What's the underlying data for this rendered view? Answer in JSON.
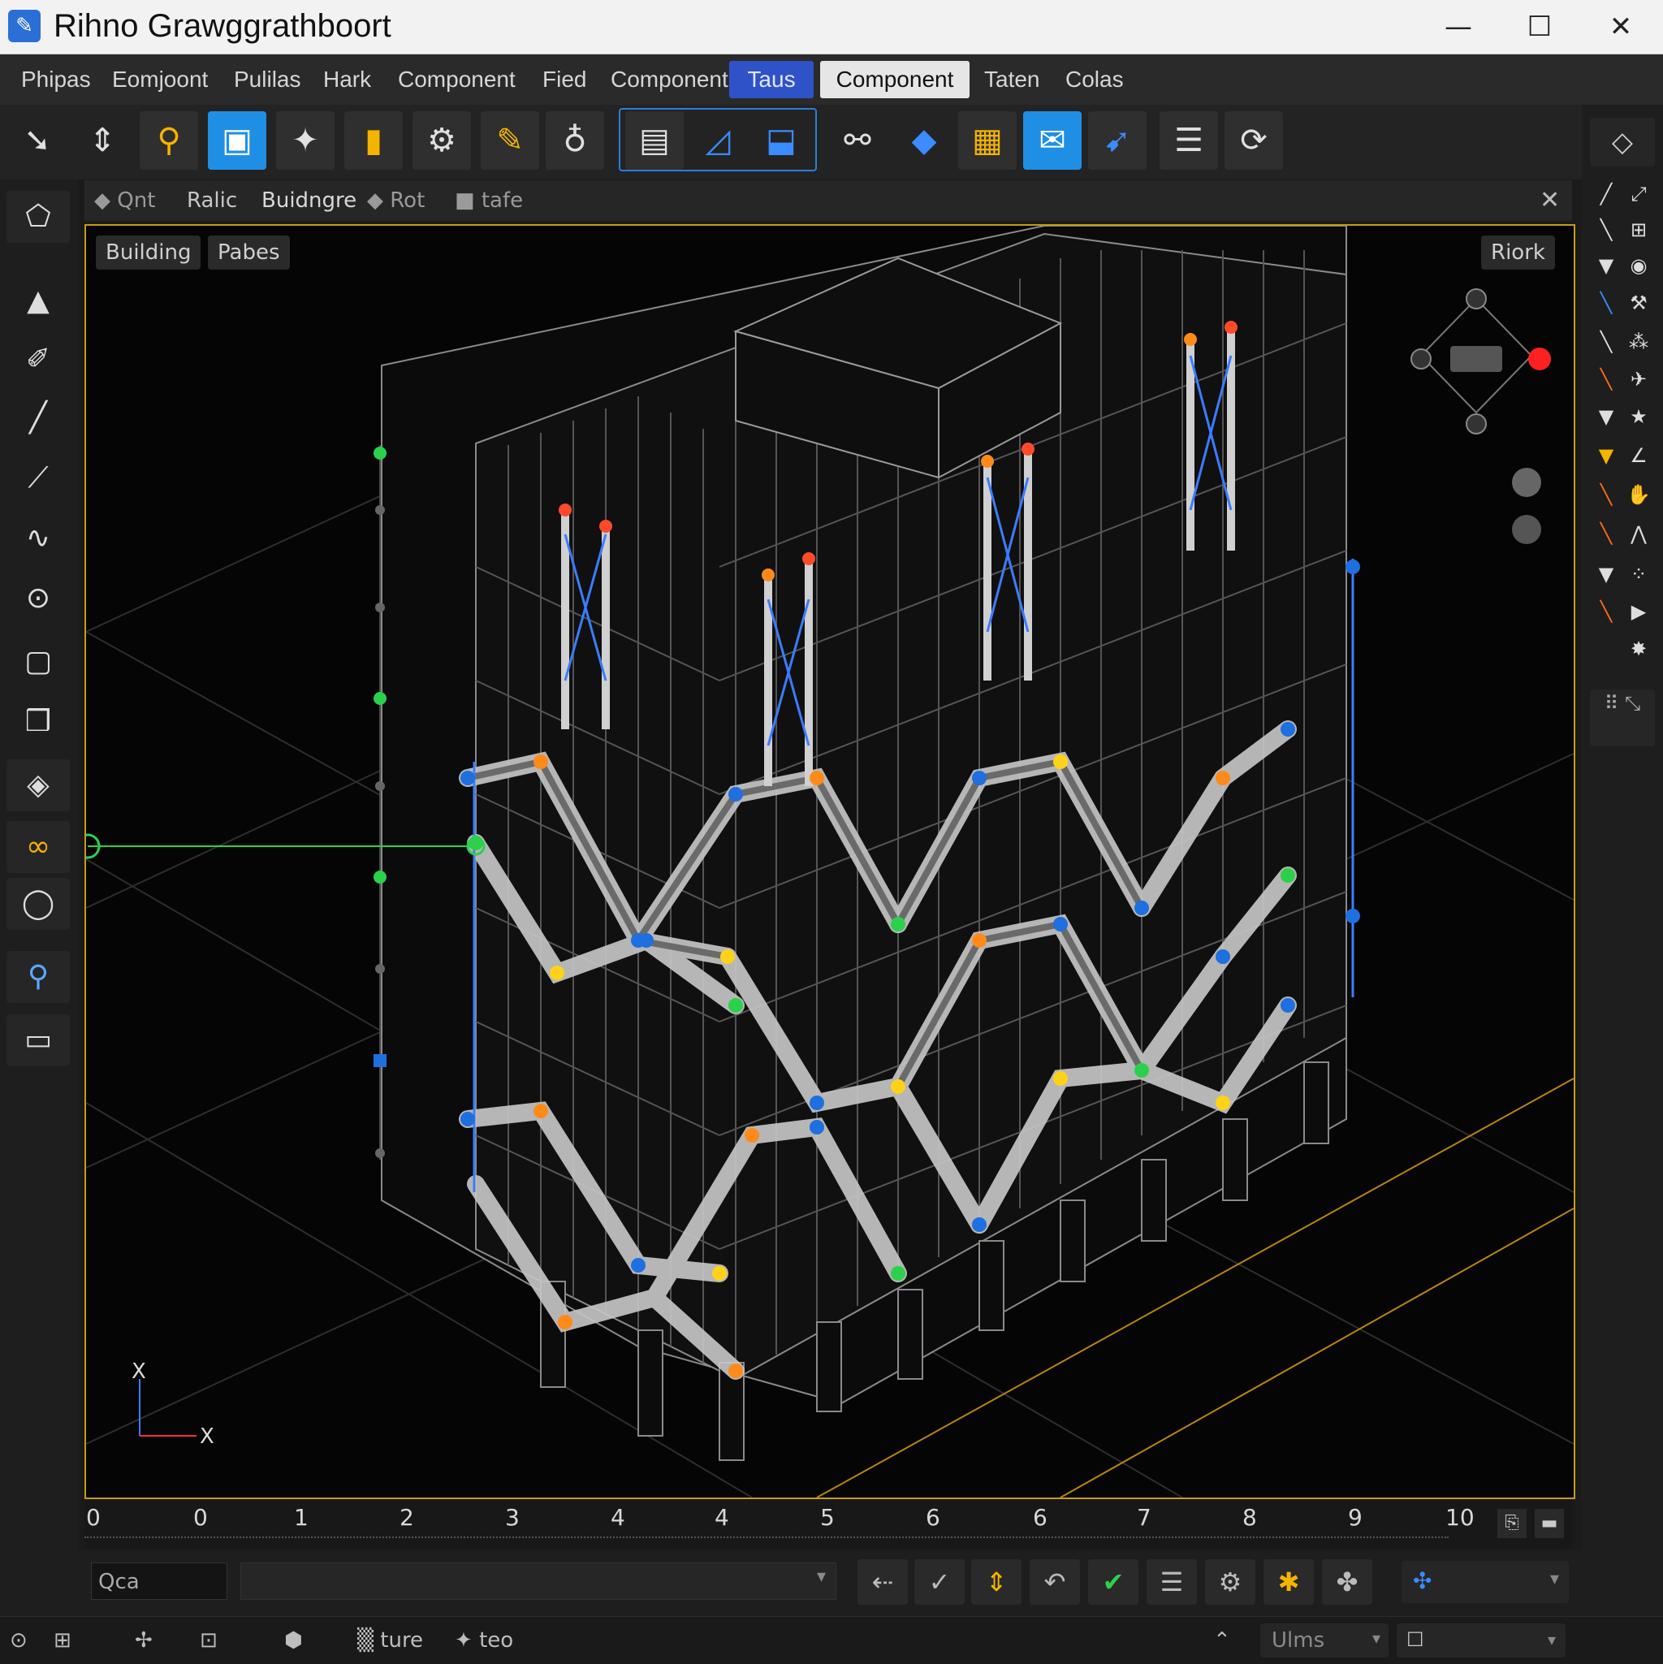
{
  "window": {
    "title": "Rihno Grawggrathboort",
    "minimize": "—",
    "maximize": "☐",
    "close": "✕"
  },
  "menu": [
    {
      "label": "Phipas"
    },
    {
      "label": "Eomjoont"
    },
    {
      "label": "Pulilas"
    },
    {
      "label": "Hark"
    },
    {
      "label": "Component"
    },
    {
      "label": "Fied"
    },
    {
      "label": "Component"
    },
    {
      "label": "Taus"
    },
    {
      "label": "Component"
    },
    {
      "label": "Taten"
    },
    {
      "label": "Colas"
    }
  ],
  "viewport_tabs": [
    "Qnt",
    "Ralic",
    "Buidngre",
    "Rot",
    "tafe"
  ],
  "viewport": {
    "chips": [
      "Building",
      "Pabes"
    ],
    "view_label": "Riork",
    "axis_x1": "X",
    "axis_x2": "X"
  },
  "timeline": {
    "ticks": [
      "0",
      "0",
      "1",
      "2",
      "3",
      "4",
      "4",
      "5",
      "6",
      "6",
      "7",
      "8",
      "9",
      "10"
    ]
  },
  "command": {
    "input_value": "Qca"
  },
  "status": {
    "item1": "ture",
    "item2": "teo",
    "units": "Ulms"
  },
  "colors": {
    "accent_blue": "#1f8fe6",
    "viewport_border": "#c89a1a",
    "node_blue": "#1e6fe0",
    "node_orange": "#ff8a1a",
    "node_yellow": "#ffd21a",
    "node_green": "#2bd14a"
  }
}
